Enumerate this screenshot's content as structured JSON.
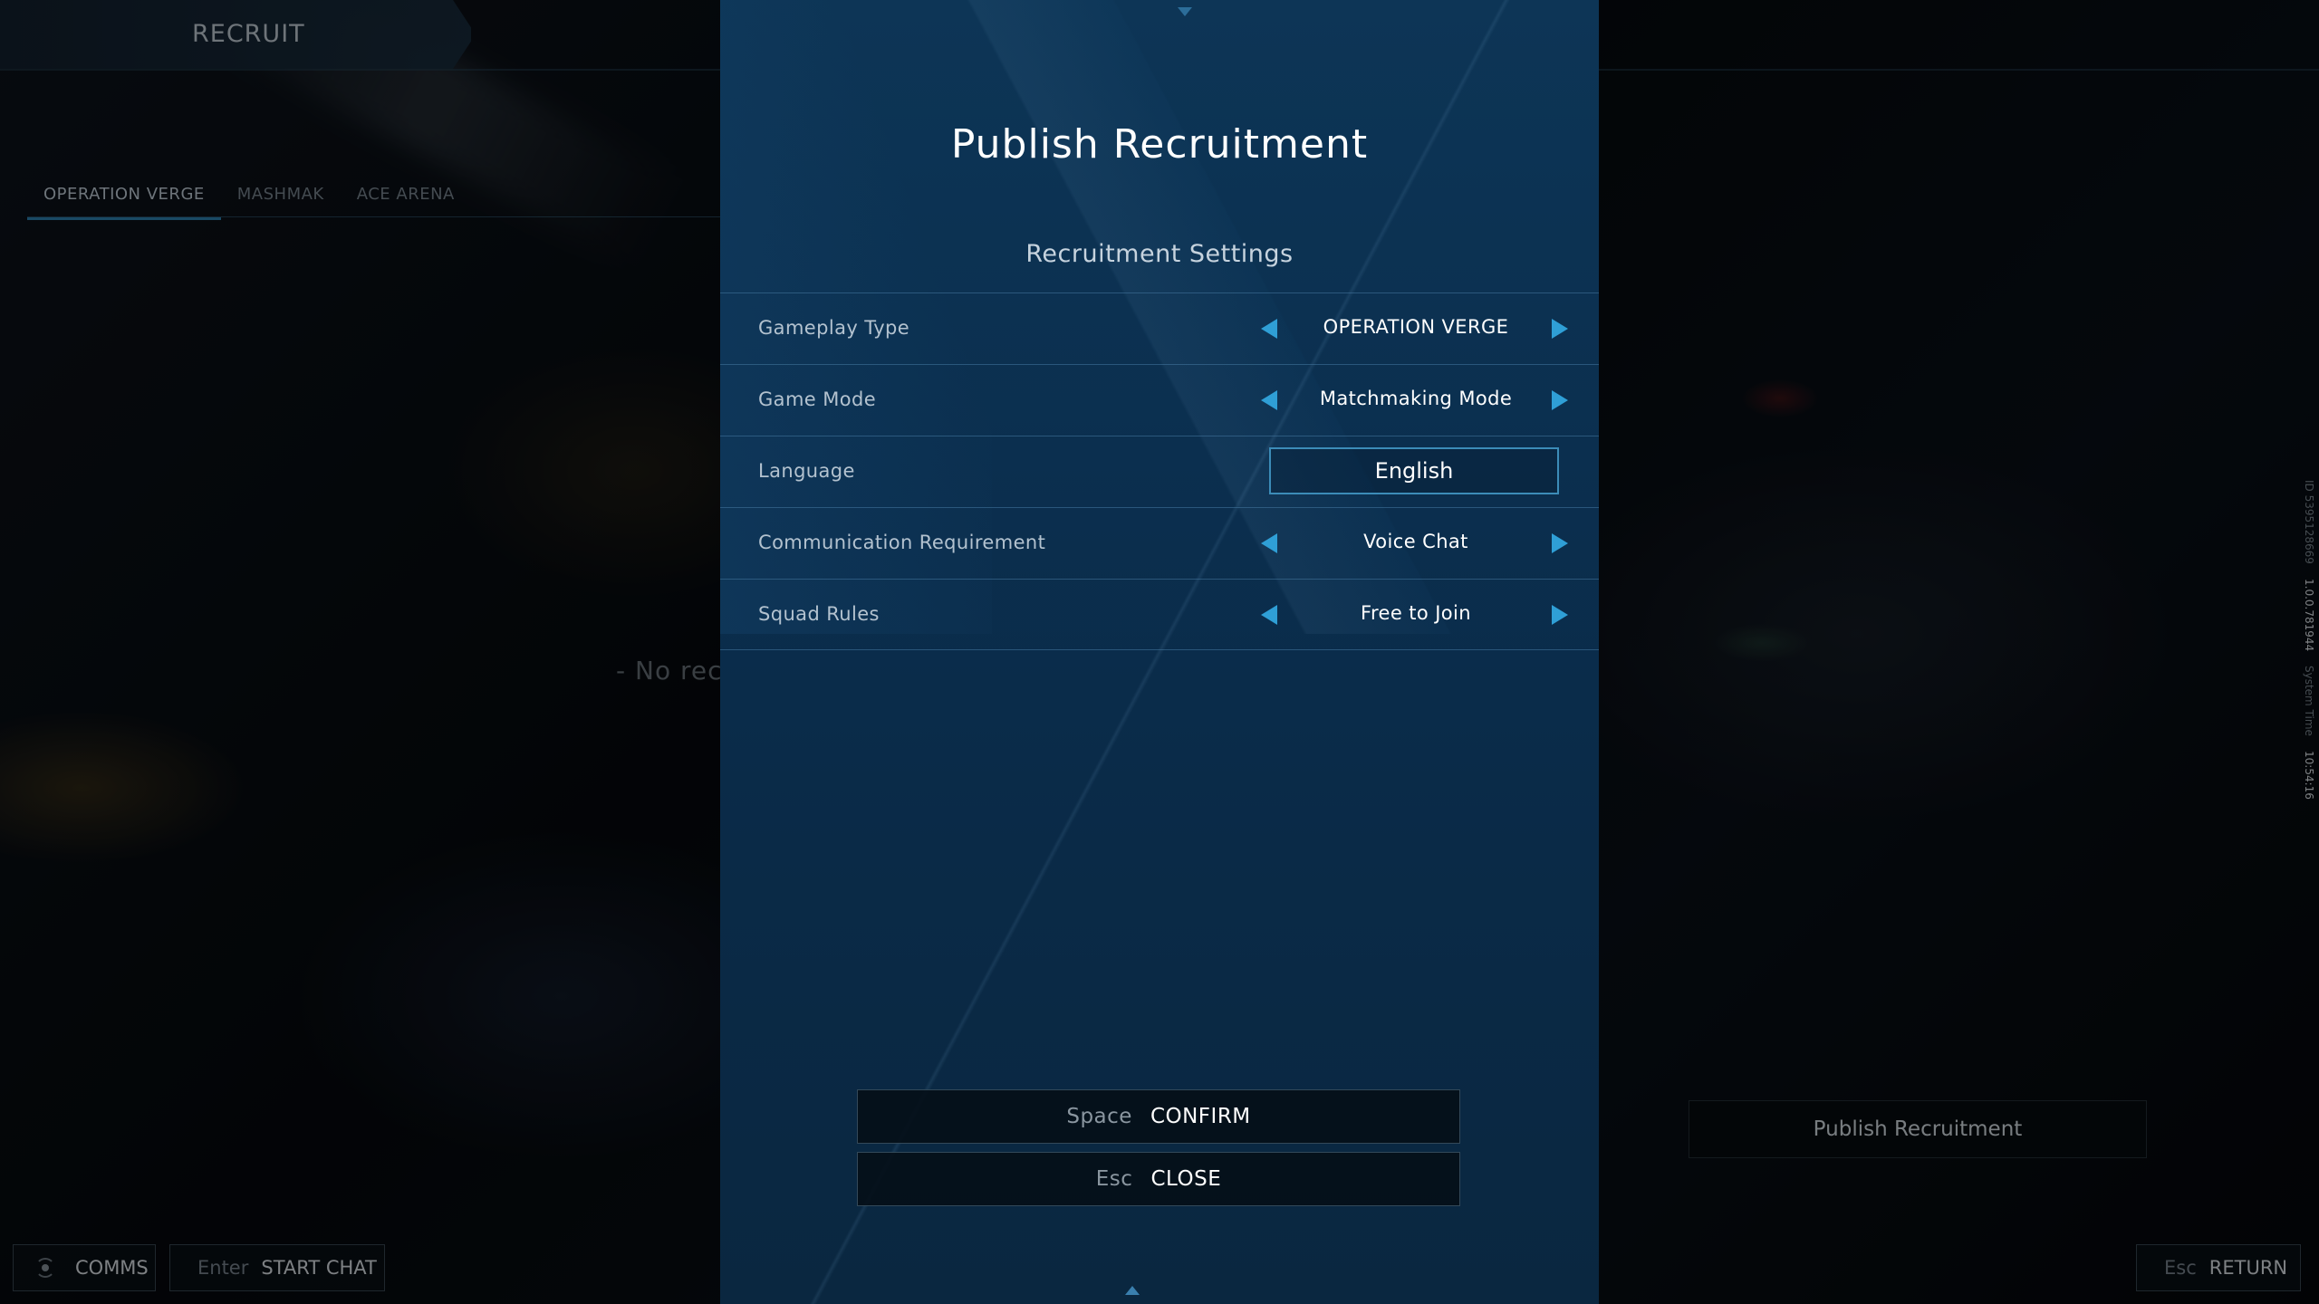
{
  "page": {
    "title": "RECRUIT"
  },
  "tabs": [
    {
      "label": "OPERATION VERGE",
      "active": true
    },
    {
      "label": "MASHMAK",
      "active": false
    },
    {
      "label": "ACE ARENA",
      "active": false
    }
  ],
  "list": {
    "empty_text": "- No recr"
  },
  "system_info": {
    "id_label": "ID 5395128669",
    "version": "1.0.0.781944",
    "time_label": "System Time",
    "time": "10:54:16"
  },
  "footer": {
    "comms_label": "COMMS",
    "chat_key": "Enter",
    "chat_label": "START CHAT",
    "return_key": "Esc",
    "return_label": "RETURN"
  },
  "right_panel": {
    "publish_label": "Publish Recruitment"
  },
  "modal": {
    "title": "Publish Recruitment",
    "section_title": "Recruitment Settings",
    "settings": [
      {
        "label": "Gameplay Type",
        "value": "OPERATION VERGE"
      },
      {
        "label": "Game Mode",
        "value": "Matchmaking Mode"
      },
      {
        "label": "Language",
        "value": "English"
      },
      {
        "label": "Communication Requirement",
        "value": "Voice Chat"
      },
      {
        "label": "Squad Rules",
        "value": "Free to Join"
      }
    ],
    "confirm_key": "Space",
    "confirm_label": "CONFIRM",
    "close_key": "Esc",
    "close_label": "CLOSE"
  },
  "colors": {
    "accent": "#2f9fd6",
    "modal_bg": "#0b2f4f",
    "tab_underline": "#2e86b6"
  },
  "icons": {
    "arrow_left": "triangle-left-icon",
    "arrow_right": "triangle-right-icon",
    "comms": "radio-signal-icon"
  }
}
